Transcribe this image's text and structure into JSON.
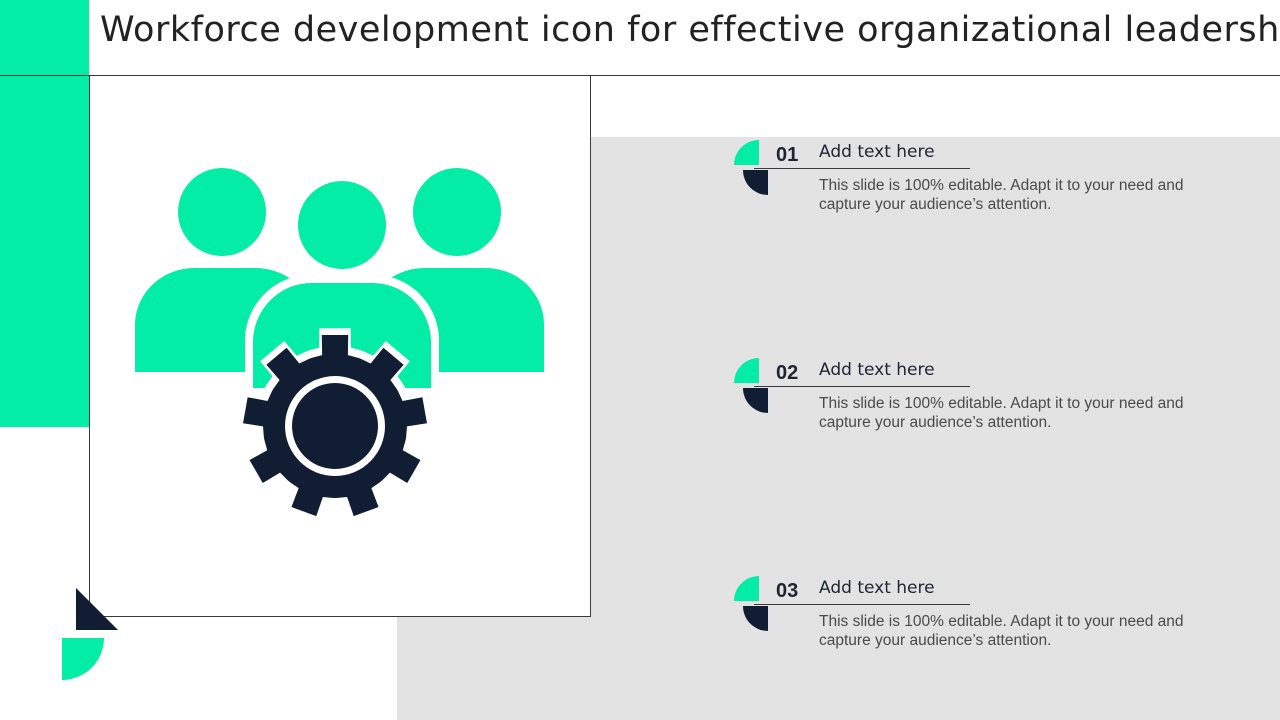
{
  "title": "Workforce development icon for effective organizational leadership",
  "colors": {
    "accent": "#03EDA6",
    "dark": "#111D33",
    "gray": "#E3E3E3"
  },
  "main_icon": "team-gear-icon",
  "items": [
    {
      "number": "01",
      "heading": "Add text here",
      "text": "This slide is 100% editable. Adapt it to your need and capture your audience’s attention."
    },
    {
      "number": "02",
      "heading": "Add text here",
      "text": "This slide is 100% editable. Adapt it to your need and capture your audience’s attention."
    },
    {
      "number": "03",
      "heading": "Add text here",
      "text": "This slide is 100% editable. Adapt it to your need and capture your audience’s attention."
    }
  ]
}
